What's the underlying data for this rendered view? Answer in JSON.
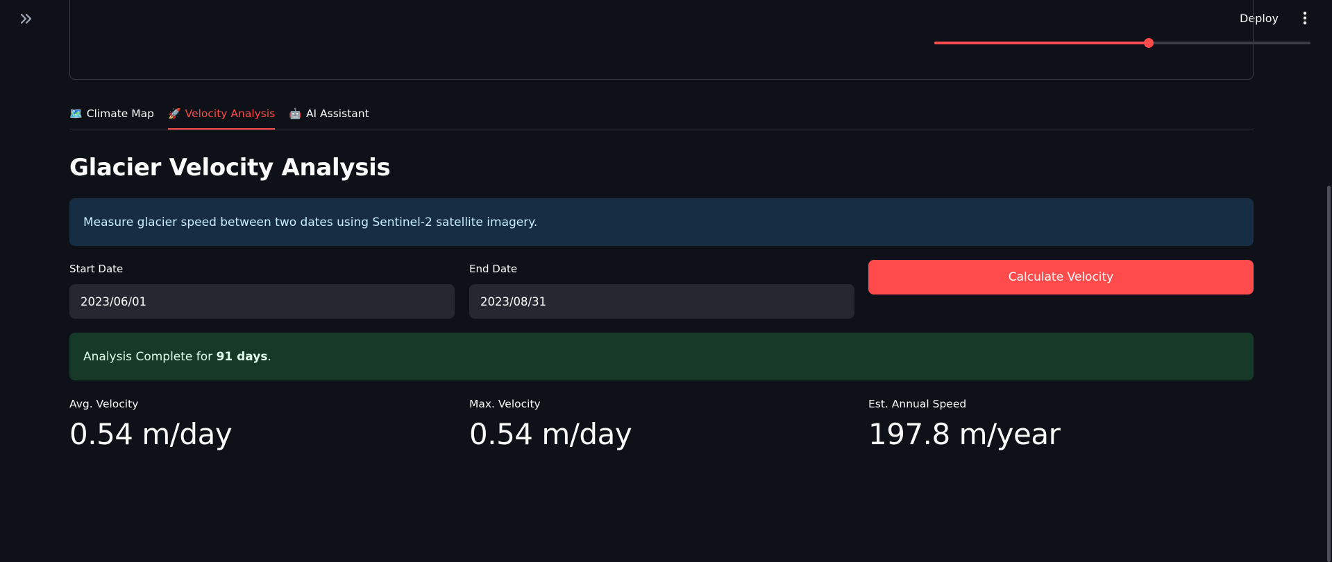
{
  "header": {
    "deploy_label": "Deploy",
    "expand_icon": "double-chevron-right-icon",
    "menu_icon": "vertical-ellipsis-icon"
  },
  "slider": {
    "value_fraction": 0.57,
    "accent": "#ff4b4b"
  },
  "tabs": [
    {
      "icon": "🗺️",
      "label": "Climate Map",
      "active": false
    },
    {
      "icon": "🚀",
      "label": "Velocity Analysis",
      "active": true
    },
    {
      "icon": "🤖",
      "label": "AI Assistant",
      "active": false
    }
  ],
  "main": {
    "title": "Glacier Velocity Analysis",
    "info": "Measure glacier speed between two dates using Sentinel-2 satellite imagery.",
    "start_date": {
      "label": "Start Date",
      "value": "2023/06/01"
    },
    "end_date": {
      "label": "End Date",
      "value": "2023/08/31"
    },
    "calculate_label": "Calculate Velocity",
    "success": {
      "prefix": "Analysis Complete for ",
      "bold": "91 days",
      "suffix": "."
    },
    "metrics": [
      {
        "label": "Avg. Velocity",
        "value": "0.54 m/day"
      },
      {
        "label": "Max. Velocity",
        "value": "0.54 m/day"
      },
      {
        "label": "Est. Annual Speed",
        "value": "197.8 m/year"
      }
    ]
  },
  "colors": {
    "background": "#0e1117",
    "accent": "#ff4b4b",
    "info_bg": "#172d43",
    "success_bg": "#173928"
  }
}
